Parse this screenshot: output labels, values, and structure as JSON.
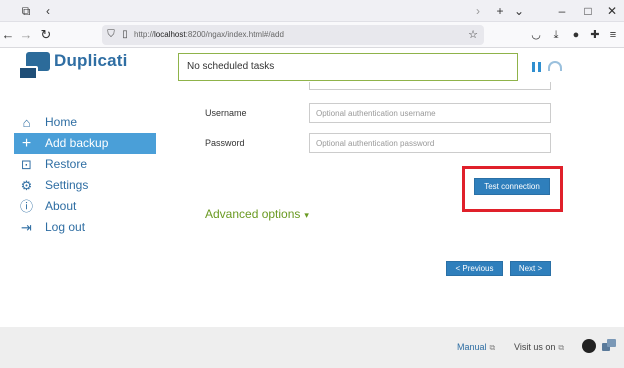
{
  "browser": {
    "url_prefix": "http://",
    "url_host": "localhost",
    "url_rest": ":8200/ngax/index.html#/add",
    "icons": [
      "tab-list-icon",
      "back-icon",
      "forward-icon",
      "reload-icon",
      "shield-icon",
      "page-icon",
      "bookmark-star-icon",
      "pocket-icon",
      "download-icon",
      "account-icon",
      "extensions-icon",
      "menu-icon",
      "chevron-right-icon",
      "chevron-down-icon",
      "minimize-icon",
      "maximize-icon",
      "close-icon"
    ]
  },
  "header": {
    "brand": "Duplicati",
    "status": "No scheduled tasks"
  },
  "sidebar": {
    "items": [
      {
        "label": "Home",
        "icon": "home-icon"
      },
      {
        "label": "Add backup",
        "icon": "plus-icon",
        "active": true
      },
      {
        "label": "Restore",
        "icon": "restore-icon"
      },
      {
        "label": "Settings",
        "icon": "gear-icon"
      },
      {
        "label": "About",
        "icon": "info-icon"
      },
      {
        "label": "Log out",
        "icon": "logout-icon"
      }
    ]
  },
  "form": {
    "username_label": "Username",
    "username_placeholder": "Optional authentication username",
    "username_value": "",
    "password_label": "Password",
    "password_placeholder": "Optional authentication password",
    "password_value": "",
    "test_connection": "Test connection",
    "advanced_options": "Advanced options",
    "previous": "< Previous",
    "next": "Next >"
  },
  "footer": {
    "manual": "Manual",
    "visit_us_on": "Visit us on"
  },
  "colors": {
    "brand_blue": "#2f6ea3",
    "active_nav": "#4a9fd8",
    "button_blue": "#2f7fbc",
    "highlight_red": "#e0202a",
    "advanced_green": "#6a9a22",
    "status_border": "#8fb34a"
  }
}
